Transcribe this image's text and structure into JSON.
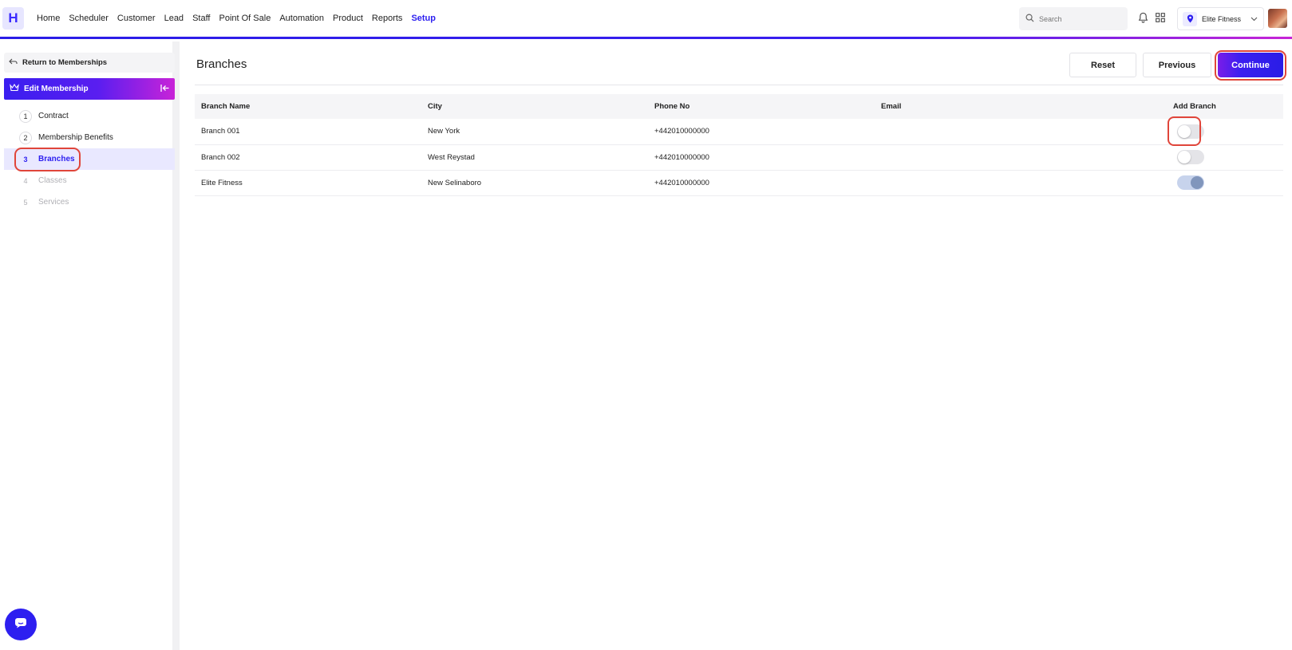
{
  "app": {
    "logo_letter": "H"
  },
  "nav": {
    "items": [
      {
        "label": "Home"
      },
      {
        "label": "Scheduler"
      },
      {
        "label": "Customer"
      },
      {
        "label": "Lead"
      },
      {
        "label": "Staff"
      },
      {
        "label": "Point Of Sale"
      },
      {
        "label": "Automation"
      },
      {
        "label": "Product"
      },
      {
        "label": "Reports"
      },
      {
        "label": "Setup",
        "active": true
      }
    ],
    "search_placeholder": "Search",
    "location": "Elite Fitness"
  },
  "sidebar": {
    "return_label": "Return to Memberships",
    "section_title": "Edit Membership",
    "steps": [
      {
        "num": "1",
        "label": "Contract",
        "state": "done"
      },
      {
        "num": "2",
        "label": "Membership Benefits",
        "state": "done"
      },
      {
        "num": "3",
        "label": "Branches",
        "state": "active"
      },
      {
        "num": "4",
        "label": "Classes",
        "state": "disabled"
      },
      {
        "num": "5",
        "label": "Services",
        "state": "disabled"
      }
    ]
  },
  "main": {
    "title": "Branches",
    "buttons": {
      "reset": "Reset",
      "previous": "Previous",
      "continue": "Continue"
    },
    "table": {
      "headers": [
        "Branch Name",
        "City",
        "Phone No",
        "Email",
        "Add Branch"
      ],
      "rows": [
        {
          "name": "Branch 001",
          "city": "New York",
          "phone": "+442010000000",
          "email": "",
          "add_branch": false
        },
        {
          "name": "Branch 002",
          "city": "West Reystad",
          "phone": "+442010000000",
          "email": "",
          "add_branch": false
        },
        {
          "name": "Elite Fitness",
          "city": "New Selinaboro",
          "phone": "+442010000000",
          "email": "",
          "add_branch": true
        }
      ]
    }
  },
  "colors": {
    "accent": "#2c1ff0",
    "highlight": "#e0453a",
    "gradient_end": "#c823d8"
  },
  "icons": [
    "search-icon",
    "bell-icon",
    "grid-icon",
    "location-pin-icon",
    "chevron-down-icon",
    "back-arrow-icon",
    "crown-icon",
    "collapse-icon",
    "chat-icon"
  ]
}
